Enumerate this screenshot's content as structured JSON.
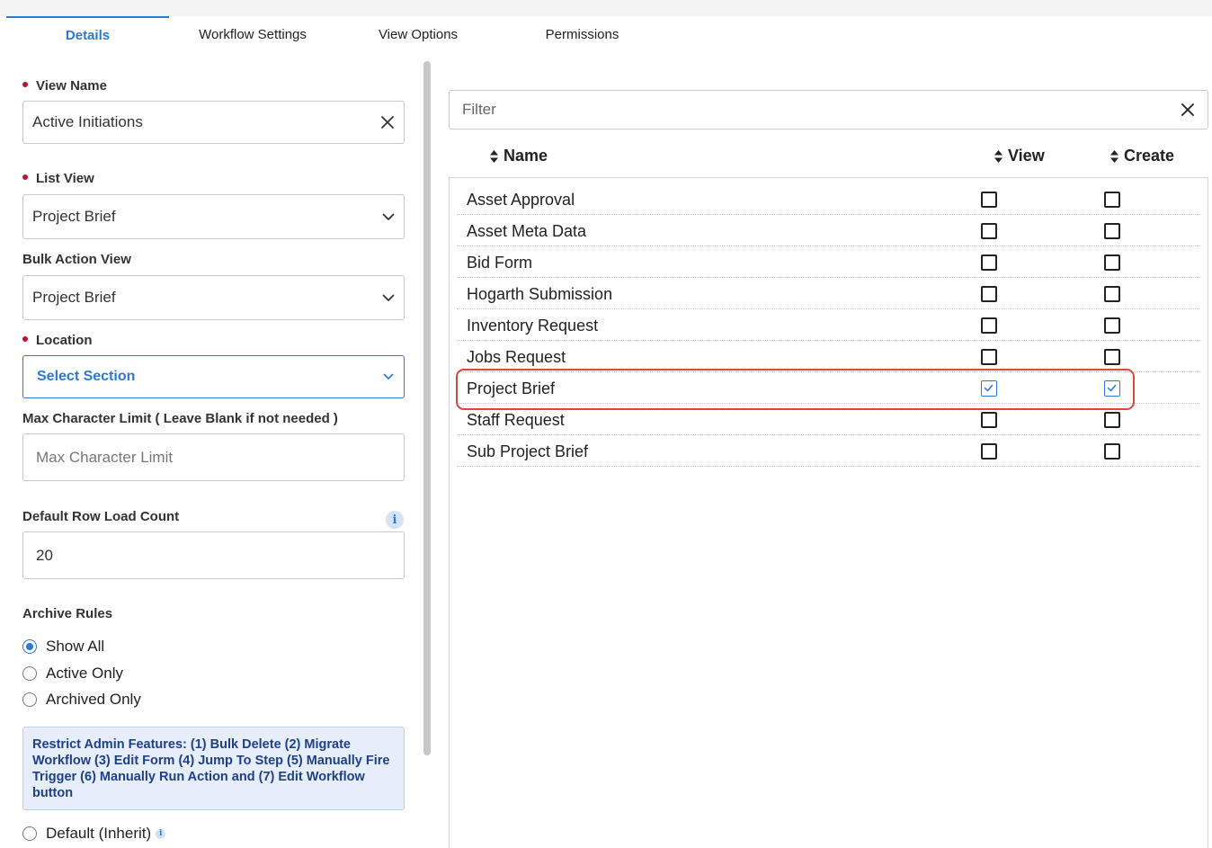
{
  "tabs": [
    "Details",
    "Workflow Settings",
    "View Options",
    "Permissions"
  ],
  "details": {
    "view_name_label": "View Name",
    "view_name_value": "Active Initiations",
    "list_view_label": "List View",
    "list_view_value": "Project Brief",
    "bulk_action_label": "Bulk Action View",
    "bulk_action_value": "Project Brief",
    "location_label": "Location",
    "location_value": "Select Section",
    "max_char_label": "Max Character Limit ( Leave Blank if not needed )",
    "max_char_placeholder": "Max Character Limit",
    "row_load_label": "Default Row Load Count",
    "row_load_value": "20",
    "archive_label": "Archive Rules",
    "archive_options": [
      "Show All",
      "Active Only",
      "Archived Only"
    ],
    "archive_selected": "Show All",
    "notice": "Restrict Admin Features: (1) Bulk Delete (2) Migrate Workflow (3) Edit Form (4) Jump To Step (5) Manually Fire Trigger (6) Manually Run Action and (7) Edit Workflow button",
    "default_inherit": "Default (Inherit)"
  },
  "permissions": {
    "filter_placeholder": "Filter",
    "columns": [
      "Name",
      "View",
      "Create"
    ],
    "rows": [
      {
        "name": "Asset Approval",
        "view": false,
        "create": false
      },
      {
        "name": "Asset Meta Data",
        "view": false,
        "create": false
      },
      {
        "name": "Bid Form",
        "view": false,
        "create": false
      },
      {
        "name": "Hogarth Submission",
        "view": false,
        "create": false
      },
      {
        "name": "Inventory Request",
        "view": false,
        "create": false
      },
      {
        "name": "Jobs Request",
        "view": false,
        "create": false
      },
      {
        "name": "Project Brief",
        "view": true,
        "create": true
      },
      {
        "name": "Staff Request",
        "view": false,
        "create": false
      },
      {
        "name": "Sub Project Brief",
        "view": false,
        "create": false
      }
    ],
    "highlighted_row": "Project Brief"
  },
  "colors": {
    "accent": "#2b78d6",
    "required": "#c0102b",
    "highlight": "#d84a3a"
  }
}
